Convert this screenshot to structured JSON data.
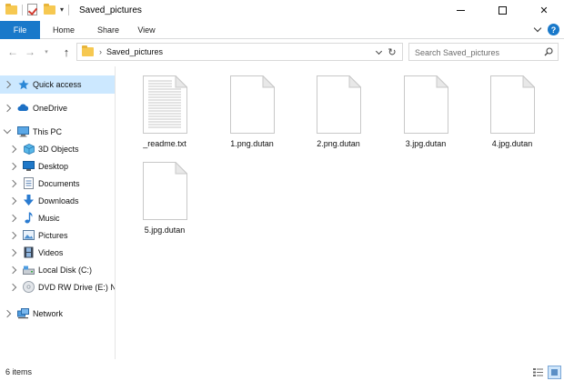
{
  "window": {
    "title": "Saved_pictures",
    "icons": {
      "folder": "folder-icon",
      "properties": "properties-check-icon",
      "new_folder": "new-folder-icon",
      "qat_dropdown": "dropdown-arrow-icon",
      "minimize": "minimize-icon",
      "maximize": "maximize-icon",
      "close": "close-icon"
    },
    "close_glyph": "✕"
  },
  "ribbon": {
    "tabs": [
      {
        "label": "File",
        "active": true
      },
      {
        "label": "Home",
        "active": false
      },
      {
        "label": "Share",
        "active": false
      },
      {
        "label": "View",
        "active": false
      }
    ],
    "help_glyph": "?",
    "accent_color": "#1979ca"
  },
  "address": {
    "path_separator": "›",
    "path": "Saved_pictures",
    "back_glyph": "←",
    "forward_glyph": "→",
    "up_glyph": "↑",
    "refresh_glyph": "↻",
    "search_placeholder": "Search Saved_pictures"
  },
  "sidebar": {
    "items": [
      {
        "label": "Quick access",
        "icon": "star-icon",
        "selected": true
      },
      {
        "label": "OneDrive",
        "icon": "cloud-icon",
        "selected": false
      },
      {
        "label": "This PC",
        "icon": "computer-icon",
        "selected": false,
        "expanded": true
      },
      {
        "label": "3D Objects",
        "icon": "cube-icon",
        "selected": false
      },
      {
        "label": "Desktop",
        "icon": "desktop-icon",
        "selected": false
      },
      {
        "label": "Documents",
        "icon": "documents-icon",
        "selected": false
      },
      {
        "label": "Downloads",
        "icon": "download-arrow-icon",
        "selected": false
      },
      {
        "label": "Music",
        "icon": "music-note-icon",
        "selected": false
      },
      {
        "label": "Pictures",
        "icon": "pictures-icon",
        "selected": false
      },
      {
        "label": "Videos",
        "icon": "film-icon",
        "selected": false
      },
      {
        "label": "Local Disk (C:)",
        "icon": "hard-drive-icon",
        "selected": false
      },
      {
        "label": "DVD RW Drive (E:) N",
        "icon": "dvd-drive-icon",
        "selected": false
      },
      {
        "label": "Network",
        "icon": "network-icon",
        "selected": false
      }
    ],
    "selection_color": "#cce8ff"
  },
  "files": [
    {
      "name": "_readme.txt",
      "icon": "text-file-icon"
    },
    {
      "name": "1.png.dutan",
      "icon": "blank-file-icon"
    },
    {
      "name": "2.png.dutan",
      "icon": "blank-file-icon"
    },
    {
      "name": "3.jpg.dutan",
      "icon": "blank-file-icon"
    },
    {
      "name": "4.jpg.dutan",
      "icon": "blank-file-icon"
    },
    {
      "name": "5.jpg.dutan",
      "icon": "blank-file-icon"
    }
  ],
  "status": {
    "item_count": "6 items",
    "view_icons": [
      "details-view-icon",
      "large-icons-view-icon"
    ]
  }
}
